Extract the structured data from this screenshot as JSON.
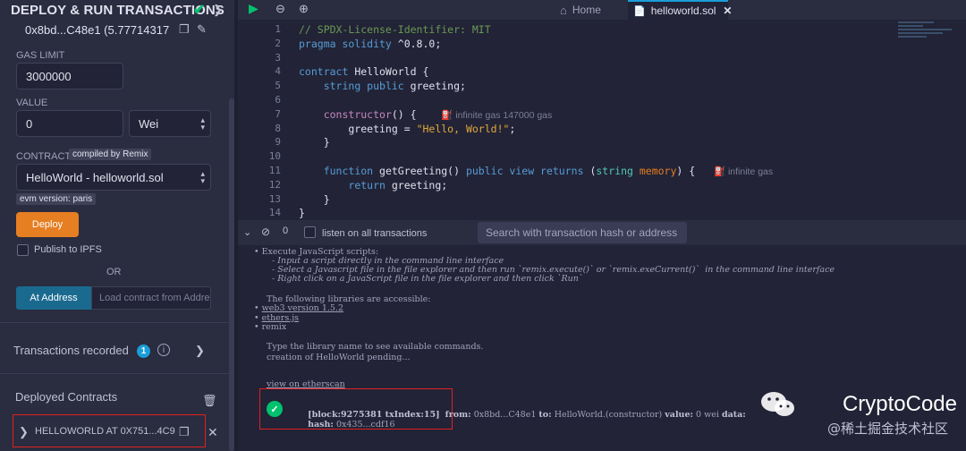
{
  "panel": {
    "title": "DEPLOY & RUN TRANSACTIONS",
    "account_value": "0x8bd...C48e1 (5.77714317",
    "gas_limit_label": "GAS LIMIT",
    "gas_limit_value": "3000000",
    "value_label": "VALUE",
    "value_amount": "0",
    "value_unit": "Wei",
    "contract_label": "CONTRACT",
    "compiled_badge": "compiled by Remix",
    "contract_selected": "HelloWorld - helloworld.sol",
    "evm_badge": "evm version: paris",
    "deploy_label": "Deploy",
    "publish_label": "Publish to IPFS",
    "or_label": "OR",
    "at_address_label": "At Address",
    "load_placeholder": "Load contract from Address",
    "tx_recorded_label": "Transactions recorded",
    "tx_recorded_count": "1",
    "deployed_label": "Deployed Contracts",
    "deployed_item": "HELLOWORLD AT 0X751...4C9"
  },
  "tabs": {
    "home": "Home",
    "file": "helloworld.sol"
  },
  "editor": {
    "lines": [
      {
        "n": "1",
        "parts": [
          {
            "c": "c-cm",
            "t": "// SPDX-License-Identifier: MIT"
          }
        ]
      },
      {
        "n": "2",
        "parts": [
          {
            "c": "c-kw",
            "t": "pragma solidity"
          },
          {
            "c": "",
            "t": " ^0.8.0;"
          }
        ]
      },
      {
        "n": "3",
        "parts": []
      },
      {
        "n": "4",
        "parts": [
          {
            "c": "c-kw",
            "t": "contract"
          },
          {
            "c": "",
            "t": " HelloWorld {"
          }
        ]
      },
      {
        "n": "5",
        "parts": [
          {
            "c": "",
            "t": "    "
          },
          {
            "c": "c-kw",
            "t": "string public"
          },
          {
            "c": "",
            "t": " greeting;"
          }
        ]
      },
      {
        "n": "6",
        "parts": []
      },
      {
        "n": "7",
        "parts": [
          {
            "c": "",
            "t": "    "
          },
          {
            "c": "c-kw2",
            "t": "constructor"
          },
          {
            "c": "",
            "t": "() {    "
          },
          {
            "c": "gas",
            "t": "⛽ infinite gas 147000 gas"
          }
        ]
      },
      {
        "n": "8",
        "parts": [
          {
            "c": "",
            "t": "        greeting = "
          },
          {
            "c": "c-str",
            "t": "\"Hello, World!\""
          },
          {
            "c": "",
            "t": ";"
          }
        ]
      },
      {
        "n": "9",
        "parts": [
          {
            "c": "",
            "t": "    }"
          }
        ]
      },
      {
        "n": "10",
        "parts": []
      },
      {
        "n": "11",
        "parts": [
          {
            "c": "",
            "t": "    "
          },
          {
            "c": "c-kw",
            "t": "function"
          },
          {
            "c": "",
            "t": " getGreeting() "
          },
          {
            "c": "c-kw",
            "t": "public view returns"
          },
          {
            "c": "",
            "t": " ("
          },
          {
            "c": "c-ty",
            "t": "string"
          },
          {
            "c": "",
            "t": " "
          },
          {
            "c": "c-mem",
            "t": "memory"
          },
          {
            "c": "",
            "t": ") {   "
          },
          {
            "c": "gas",
            "t": "⛽ infinite gas"
          }
        ]
      },
      {
        "n": "12",
        "parts": [
          {
            "c": "",
            "t": "        "
          },
          {
            "c": "c-kw",
            "t": "return"
          },
          {
            "c": "",
            "t": " greeting;"
          }
        ]
      },
      {
        "n": "13",
        "parts": [
          {
            "c": "",
            "t": "    }"
          }
        ]
      },
      {
        "n": "14",
        "parts": [
          {
            "c": "",
            "t": "}"
          }
        ]
      }
    ]
  },
  "terminal": {
    "listen_label": "listen on all transactions",
    "search_placeholder": "Search with transaction hash or address",
    "execute_title": "Execute JavaScript scripts:",
    "execute_1": "- Input a script directly in the command line interface",
    "execute_2": "- Select a Javascript file in the file explorer and then run `remix.execute()` or `remix.exeCurrent()`  in the command line interface",
    "execute_3": "- Right click on a JavaScript file in the file explorer and then click `Run`",
    "libs_title": "The following libraries are accessible:",
    "lib_1": "web3 version 1.5.2",
    "lib_2": "ethers.js",
    "lib_3": "remix",
    "type_hint": "Type the library name to see available commands.",
    "pending": "creation of HelloWorld pending...",
    "view_link": "view on etherscan",
    "tx_block": "[block:9275381 txIndex:15]",
    "tx_from_label": "from:",
    "tx_from": "0x8bd...C48e1",
    "tx_to_label": "to:",
    "tx_to": "HelloWorld.(constructor)",
    "tx_value_label": "value:",
    "tx_value": "0 wei",
    "tx_data_label": "data:",
    "tx_hash_label": "hash:",
    "tx_hash": "0x435...cdf16"
  },
  "watermark": {
    "brand": "CryptoCode",
    "sub": "@稀土掘金技术社区"
  }
}
